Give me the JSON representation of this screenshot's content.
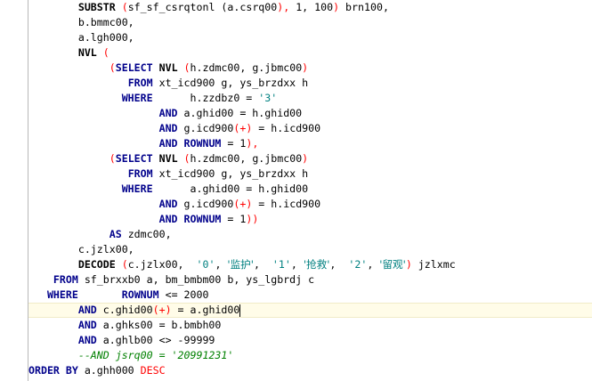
{
  "editor": {
    "lines": [
      [
        {
          "t": "        "
        },
        {
          "t": "SUBSTR",
          "c": "fn"
        },
        {
          "t": " "
        },
        {
          "t": "(",
          "c": "op"
        },
        {
          "t": "sf_sf_csrqtonl",
          "c": "id"
        },
        {
          "t": " ("
        },
        {
          "t": "a.csrq00"
        },
        {
          "t": "),",
          "c": "op"
        },
        {
          "t": " 1, 100",
          "c": "num"
        },
        {
          "t": ")",
          "c": "op"
        },
        {
          "t": " brn100,"
        }
      ],
      [
        {
          "t": "        b.bmmc00,"
        }
      ],
      [
        {
          "t": "        a.lgh000,"
        }
      ],
      [
        {
          "t": "        "
        },
        {
          "t": "NVL",
          "c": "fn"
        },
        {
          "t": " "
        },
        {
          "t": "(",
          "c": "op"
        }
      ],
      [
        {
          "t": "             "
        },
        {
          "t": "(",
          "c": "op"
        },
        {
          "t": "SELECT",
          "c": "kw"
        },
        {
          "t": " "
        },
        {
          "t": "NVL",
          "c": "fn"
        },
        {
          "t": " "
        },
        {
          "t": "(",
          "c": "op"
        },
        {
          "t": "h.zdmc00, g.jbmc00"
        },
        {
          "t": ")",
          "c": "op"
        }
      ],
      [
        {
          "t": "                "
        },
        {
          "t": "FROM",
          "c": "kw"
        },
        {
          "t": " xt_icd900 g, ys_brzdxx h"
        }
      ],
      [
        {
          "t": "               "
        },
        {
          "t": "WHERE",
          "c": "kw"
        },
        {
          "t": "      h.zzdbz0 = "
        },
        {
          "t": "'3'",
          "c": "str"
        }
      ],
      [
        {
          "t": "                     "
        },
        {
          "t": "AND",
          "c": "kw"
        },
        {
          "t": " a.ghid00 = h.ghid00"
        }
      ],
      [
        {
          "t": "                     "
        },
        {
          "t": "AND",
          "c": "kw"
        },
        {
          "t": " g.icd900"
        },
        {
          "t": "(+)",
          "c": "op"
        },
        {
          "t": " = h.icd900"
        }
      ],
      [
        {
          "t": "                     "
        },
        {
          "t": "AND",
          "c": "kw"
        },
        {
          "t": " "
        },
        {
          "t": "ROWNUM",
          "c": "kw"
        },
        {
          "t": " = 1"
        },
        {
          "t": "),",
          "c": "op"
        }
      ],
      [
        {
          "t": "             "
        },
        {
          "t": "(",
          "c": "op"
        },
        {
          "t": "SELECT",
          "c": "kw"
        },
        {
          "t": " "
        },
        {
          "t": "NVL",
          "c": "fn"
        },
        {
          "t": " "
        },
        {
          "t": "(",
          "c": "op"
        },
        {
          "t": "h.zdmc00, g.jbmc00"
        },
        {
          "t": ")",
          "c": "op"
        }
      ],
      [
        {
          "t": "                "
        },
        {
          "t": "FROM",
          "c": "kw"
        },
        {
          "t": " xt_icd900 g, ys_brzdxx h"
        }
      ],
      [
        {
          "t": "               "
        },
        {
          "t": "WHERE",
          "c": "kw"
        },
        {
          "t": "      a.ghid00 = h.ghid00"
        }
      ],
      [
        {
          "t": "                     "
        },
        {
          "t": "AND",
          "c": "kw"
        },
        {
          "t": " g.icd900"
        },
        {
          "t": "(+)",
          "c": "op"
        },
        {
          "t": " = h.icd900"
        }
      ],
      [
        {
          "t": "                     "
        },
        {
          "t": "AND",
          "c": "kw"
        },
        {
          "t": " "
        },
        {
          "t": "ROWNUM",
          "c": "kw"
        },
        {
          "t": " = 1"
        },
        {
          "t": "))",
          "c": "op"
        }
      ],
      [
        {
          "t": "             "
        },
        {
          "t": "AS",
          "c": "kw"
        },
        {
          "t": " zdmc00,"
        }
      ],
      [
        {
          "t": "        c.jzlx00,"
        }
      ],
      [
        {
          "t": "        "
        },
        {
          "t": "DECODE",
          "c": "fn"
        },
        {
          "t": " "
        },
        {
          "t": "(",
          "c": "op"
        },
        {
          "t": "c.jzlx00,  "
        },
        {
          "t": "'0'",
          "c": "str"
        },
        {
          "t": ", "
        },
        {
          "t": "'监护'",
          "c": "cjk"
        },
        {
          "t": ",  "
        },
        {
          "t": "'1'",
          "c": "str"
        },
        {
          "t": ", "
        },
        {
          "t": "'抢救'",
          "c": "cjk"
        },
        {
          "t": ",  "
        },
        {
          "t": "'2'",
          "c": "str"
        },
        {
          "t": ", "
        },
        {
          "t": "'留观'",
          "c": "cjk"
        },
        {
          "t": ")",
          "c": "op"
        },
        {
          "t": " jzlxmc"
        }
      ],
      [
        {
          "t": "    "
        },
        {
          "t": "FROM",
          "c": "kw"
        },
        {
          "t": " sf_brxxb0 a, bm_bmbm00 b, ys_lgbrdj c"
        }
      ],
      [
        {
          "t": "   "
        },
        {
          "t": "WHERE",
          "c": "kw"
        },
        {
          "t": "       "
        },
        {
          "t": "ROWNUM",
          "c": "kw"
        },
        {
          "t": " <= 2000"
        }
      ],
      [
        {
          "t": "        "
        },
        {
          "t": "AND",
          "c": "kw"
        },
        {
          "t": " c.ghid00"
        },
        {
          "t": "(+)",
          "c": "op"
        },
        {
          "t": " = a.ghid00"
        },
        {
          "t": "",
          "caret": true
        }
      ],
      [
        {
          "t": "        "
        },
        {
          "t": "AND",
          "c": "kw"
        },
        {
          "t": " a.ghks00 = b.bmbh00"
        }
      ],
      [
        {
          "t": "        "
        },
        {
          "t": "AND",
          "c": "kw"
        },
        {
          "t": " a.ghlb00 <> -99999"
        }
      ],
      [
        {
          "t": "        "
        },
        {
          "t": "--AND jsrq00 = '20991231'",
          "c": "cmt"
        }
      ],
      [
        {
          "t": "ORDER BY",
          "c": "kw"
        },
        {
          "t": " a.ghh000 "
        },
        {
          "t": "DESC",
          "c": "op"
        }
      ]
    ],
    "current_line_index": 20
  }
}
